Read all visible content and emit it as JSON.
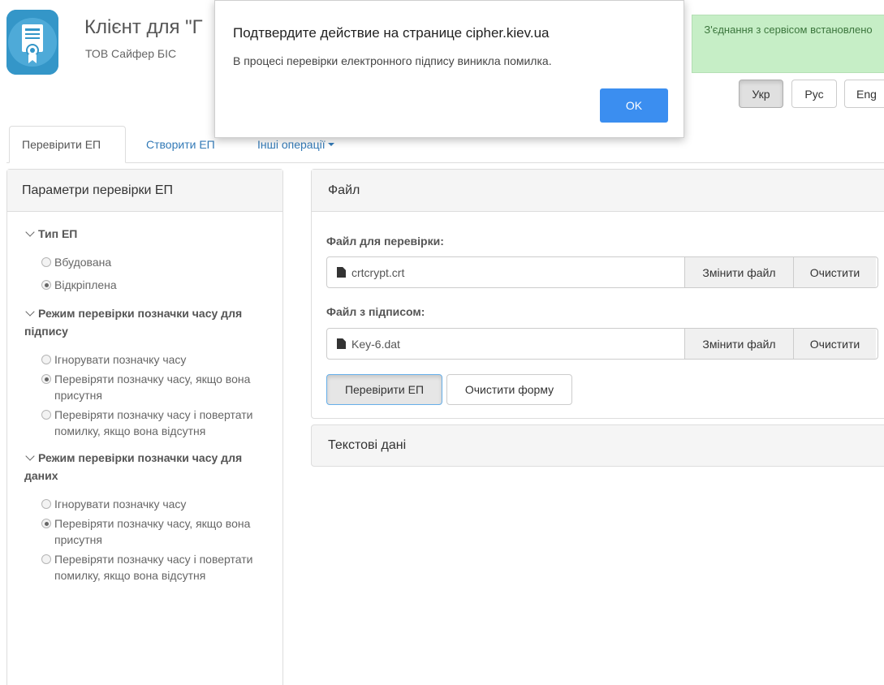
{
  "header": {
    "app_title": "Клієнт для \"Г",
    "app_subtitle": "ТОВ Сайфер БІС",
    "logo_icon": "certificate-icon",
    "status_text": "З'єднання з сервісом встановлено",
    "status_color": "#c6eec6",
    "languages": [
      {
        "label": "Укр",
        "active": true
      },
      {
        "label": "Рус",
        "active": false
      },
      {
        "label": "Eng",
        "active": false
      }
    ]
  },
  "tabs": [
    {
      "label": "Перевірити ЕП",
      "active": true
    },
    {
      "label": "Створити ЕП",
      "active": false
    },
    {
      "label": "Інші операції",
      "active": false,
      "dropdown": true
    }
  ],
  "left_panel": {
    "heading": "Параметри перевірки ЕП",
    "groups": [
      {
        "title": "Тип ЕП",
        "options": [
          {
            "label": "Вбудована",
            "checked": false
          },
          {
            "label": "Відкріплена",
            "checked": true
          }
        ]
      },
      {
        "title": "Режим перевірки позначки часу для підпису",
        "options": [
          {
            "label": "Ігнорувати позначку часу",
            "checked": false
          },
          {
            "label": "Перевіряти позначку часу, якщо вона присутня",
            "checked": true
          },
          {
            "label": "Перевіряти позначку часу і повертати помилку, якщо вона відсутня",
            "checked": false
          }
        ]
      },
      {
        "title": "Режим перевірки позначки часу для даних",
        "options": [
          {
            "label": "Ігнорувати позначку часу",
            "checked": false
          },
          {
            "label": "Перевіряти позначку часу, якщо вона присутня",
            "checked": true
          },
          {
            "label": "Перевіряти позначку часу і повертати помилку, якщо вона відсутня",
            "checked": false
          }
        ]
      }
    ]
  },
  "file_panel": {
    "heading": "Файл",
    "file_to_check_label": "Файл для перевірки:",
    "file_to_check_value": "crtcrypt.crt",
    "signature_file_label": "Файл з підписом:",
    "signature_file_value": "Key-6.dat",
    "change_file_label": "Змінити файл",
    "clear_label": "Очистити",
    "verify_button": "Перевірити ЕП",
    "clear_form_button": "Очистити форму"
  },
  "text_panel": {
    "heading": "Текстові дані"
  },
  "dialog": {
    "title": "Подтвердите действие на странице cipher.kiev.ua",
    "message": "В процесі перевірки електронного підпису виникла помилка.",
    "ok_label": "OK",
    "ok_color": "#3b8ef0"
  }
}
